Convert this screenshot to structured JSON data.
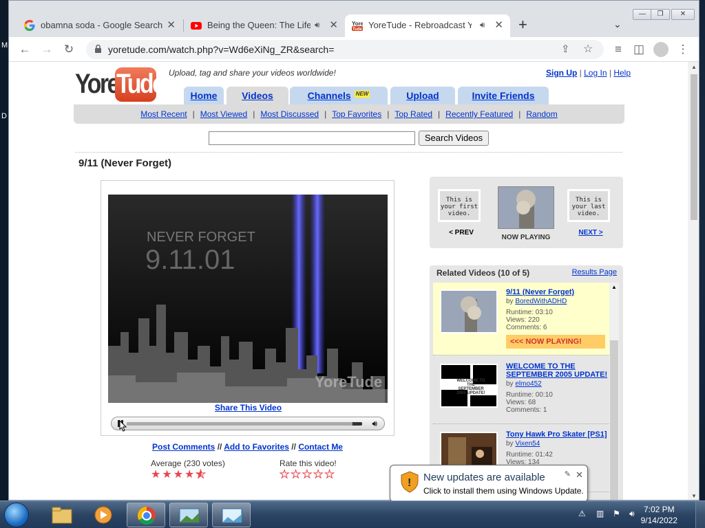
{
  "desktop": {
    "edge_letters": [
      "M",
      "D"
    ]
  },
  "browser": {
    "tabs": [
      {
        "title": "obamna soda - Google Search",
        "favicon": "google-g-icon",
        "audio": false,
        "active": false
      },
      {
        "title": "Being the Queen: The Life of",
        "favicon": "youtube-icon",
        "audio": true,
        "active": false
      },
      {
        "title": "YoreTude - Rebroadcast Your",
        "favicon": "yoretude-icon",
        "audio": true,
        "active": true
      }
    ],
    "new_tab": "+",
    "url": "yoretude.com/watch.php?v=Wd6eXiNg_ZR&search=",
    "window_controls": [
      "minimize",
      "maximize",
      "close"
    ]
  },
  "site": {
    "logo_left": "Yore",
    "logo_right": "Tude",
    "tagline": "Upload, tag and share your videos worldwide!",
    "top_links": [
      "Sign Up",
      "Log In",
      "Help"
    ],
    "top_link_sep": "|",
    "nav_tabs": [
      "Home",
      "Videos",
      "Channels",
      "Upload",
      "Invite Friends"
    ],
    "new_badge": "NEW",
    "sub_nav": [
      "Most Recent",
      "Most Viewed",
      "Most Discussed",
      "Top Favorites",
      "Top Rated",
      "Recently Featured",
      "Random"
    ],
    "search_button": "Search Videos",
    "search_value": ""
  },
  "video": {
    "title": "9/11 (Never Forget)",
    "frame_line1": "NEVER FORGET",
    "frame_line2": "9.11.01",
    "watermark": "YoreTude",
    "share_label": "Share This Video",
    "progress": 0.0,
    "buffered": 0.96,
    "actions": [
      "Post Comments",
      "Add to Favorites",
      "Contact Me"
    ],
    "actions_sep": "//",
    "average_label": "Average (230 votes)",
    "average_rating": 4.5,
    "rate_label": "Rate this video!",
    "max_stars": 5
  },
  "nav_box": {
    "prev_text": "This is your first video.",
    "prev_label": "< PREV",
    "now_label": "NOW PLAYING",
    "next_text": "This is your last video.",
    "next_label": "NEXT >"
  },
  "related": {
    "header": "Related Videos (10 of 5)",
    "results_link": "Results Page",
    "by_label": "by",
    "items": [
      {
        "title": "9/11 (Never Forget)",
        "by": "BoredWithADHD",
        "runtime": "Runtime: 03:10",
        "views": "Views: 220",
        "comments": "Comments: 6",
        "now": true,
        "now_label": "<<< NOW PLAYING!"
      },
      {
        "title": "WELCOME TO THE SEPTEMBER 2005 UPDATE!",
        "by": "elmo452",
        "runtime": "Runtime: 00:10",
        "views": "Views: 68",
        "comments": "Comments: 1",
        "now": false,
        "thumb_text": "WELCOME TO THE SEPTEMBER 2005 UPDATE!"
      },
      {
        "title": "Tony Hawk Pro Skater [PS1]",
        "by": "Vixen54",
        "runtime": "Runtime: 01:42",
        "views": "Views: 134",
        "comments": "",
        "now": false
      }
    ]
  },
  "notification": {
    "title": "New updates are available",
    "body": "Click to install them using Windows Update."
  },
  "taskbar": {
    "time": "7:02 PM",
    "date": "9/14/2022"
  },
  "colors": {
    "link": "#0033cc",
    "nav_tab": "#c6d8ee",
    "star": "#e8454e",
    "now_playing_bg": "#ffffcc",
    "now_playing_bar": "#ffcc66"
  }
}
